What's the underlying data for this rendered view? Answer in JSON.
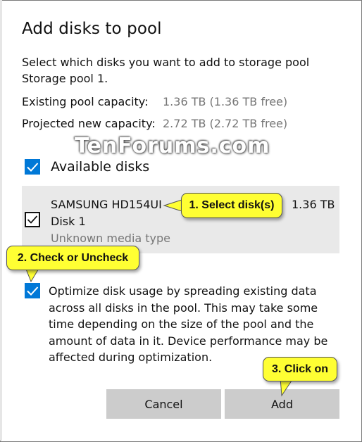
{
  "dialog": {
    "title": "Add disks to pool",
    "description": "Select which disks you want to add to storage pool Storage pool 1."
  },
  "capacity": {
    "existing_label": "Existing pool capacity:",
    "existing_value": "1.36 TB (1.36 TB free)",
    "projected_label": "Projected new capacity:",
    "projected_value": "2.72 TB (2.72 TB free)"
  },
  "watermark": "TenForums.com",
  "available_disks": {
    "label": "Available disks",
    "checked": true
  },
  "disk": {
    "name": "SAMSUNG HD154UI",
    "size": "1.36 TB",
    "number": "Disk 1",
    "media_type": "Unknown media type",
    "checked": true
  },
  "optimize": {
    "checked": true,
    "text": "Optimize disk usage by spreading existing data across all disks in the pool. This may take some time depending on the size of the pool and the amount of data in it. Device performance may be affected during optimization."
  },
  "buttons": {
    "cancel": "Cancel",
    "add": "Add"
  },
  "callouts": {
    "step1": "1. Select disk(s)",
    "step2": "2. Check or Uncheck",
    "step3": "3. Click on"
  },
  "colors": {
    "accent": "#0078d7",
    "callout": "#ffff33",
    "button": "#cccccc",
    "disk_panel": "#e9e9e9",
    "secondary_text": "#767676"
  }
}
